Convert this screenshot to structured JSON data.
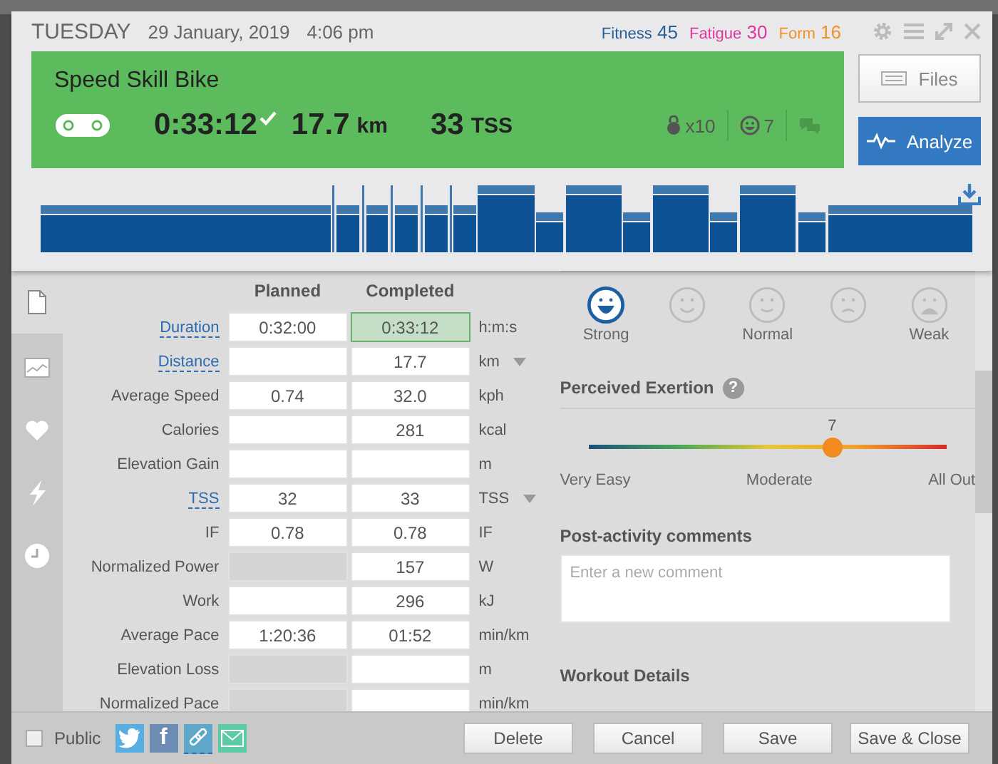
{
  "header": {
    "day": "TUESDAY",
    "date": "29 January, 2019",
    "time": "4:06 pm",
    "metrics": [
      {
        "label": "Fitness",
        "value": "45",
        "color": "#2a5f96"
      },
      {
        "label": "Fatigue",
        "value": "30",
        "color": "#e0379f"
      },
      {
        "label": "Form",
        "value": "16",
        "color": "#f0912a"
      }
    ]
  },
  "workout": {
    "title": "Speed Skill Bike",
    "duration": "0:33:12",
    "completed": true,
    "distance": "17.7",
    "distance_unit": "km",
    "tss": "33",
    "tss_unit": "TSS",
    "strength": "x10",
    "feel": "7"
  },
  "side_buttons": [
    {
      "label": "Files",
      "selected": false
    },
    {
      "label": "Analyze",
      "selected": true
    }
  ],
  "side_tabs": [
    {
      "kind": "document",
      "selected": true
    },
    {
      "kind": "chart",
      "selected": false
    },
    {
      "kind": "heart",
      "selected": false
    },
    {
      "kind": "bolt",
      "selected": false
    },
    {
      "kind": "clock",
      "selected": false
    }
  ],
  "table": {
    "columns": [
      "Planned",
      "Completed"
    ],
    "rows": [
      {
        "label": "Duration",
        "link": true,
        "planned": "0:32:00",
        "planned_disabled": false,
        "completed": "0:33:12",
        "completed_highlight": true,
        "unit": "h:m:s",
        "dropdown": false
      },
      {
        "label": "Distance",
        "link": true,
        "planned_disabled": false,
        "completed": "17.7",
        "completed_highlight": false,
        "unit": "km",
        "dropdown": true
      },
      {
        "label": "Average Speed",
        "link": false,
        "planned": "0.74",
        "planned_disabled": false,
        "completed": "32.0",
        "completed_highlight": false,
        "unit": "kph",
        "dropdown": false
      },
      {
        "label": "Calories",
        "link": false,
        "planned_disabled": false,
        "completed": "281",
        "completed_highlight": false,
        "unit": "kcal",
        "dropdown": false
      },
      {
        "label": "Elevation Gain",
        "link": false,
        "planned_disabled": false,
        "completed_highlight": false,
        "unit": "m",
        "dropdown": false
      },
      {
        "label": "TSS",
        "link": true,
        "planned": "32",
        "planned_disabled": false,
        "completed": "33",
        "completed_highlight": false,
        "unit": "TSS",
        "dropdown": true
      },
      {
        "label": "IF",
        "link": false,
        "planned": "0.78",
        "planned_disabled": false,
        "completed": "0.78",
        "completed_highlight": false,
        "unit": "IF",
        "dropdown": false
      },
      {
        "label": "Normalized Power",
        "link": false,
        "planned_disabled": true,
        "completed": "157",
        "completed_highlight": false,
        "unit": "W",
        "dropdown": false
      },
      {
        "label": "Work",
        "link": false,
        "planned_disabled": false,
        "completed": "296",
        "completed_highlight": false,
        "unit": "kJ",
        "dropdown": false
      },
      {
        "label": "Average Pace",
        "link": false,
        "planned": "1:20:36",
        "planned_disabled": false,
        "completed": "01:52",
        "completed_highlight": false,
        "unit": "min/km",
        "dropdown": false
      },
      {
        "label": "Elevation Loss",
        "link": false,
        "planned_disabled": true,
        "completed_highlight": false,
        "unit": "m",
        "dropdown": false
      },
      {
        "label": "Normalized Pace",
        "link": false,
        "planned_disabled": true,
        "completed_highlight": false,
        "unit": "min/km",
        "dropdown": false
      }
    ]
  },
  "feelings": [
    {
      "label": "Strong",
      "selected": true
    },
    {
      "selected": false
    },
    {
      "label": "Normal",
      "selected": false
    },
    {
      "selected": false
    },
    {
      "label": "Weak",
      "selected": false
    }
  ],
  "exertion": {
    "title": "Perceived Exertion",
    "help": "?",
    "reading": "7",
    "level": 0.68,
    "labels": [
      "Very Easy",
      "Moderate",
      "All Out"
    ]
  },
  "comments": {
    "title": "Post-activity comments",
    "placeholder": "Enter a new comment"
  },
  "details_title": "Workout Details",
  "footer": {
    "public_label": "Public",
    "public": false,
    "share": [
      {
        "kind": "bird"
      },
      {
        "kind": "letter",
        "label": "f"
      },
      {
        "kind": "link"
      },
      {
        "kind": "mail"
      }
    ],
    "buttons": [
      "Delete",
      "Cancel",
      "Save",
      "Save & Close"
    ]
  }
}
